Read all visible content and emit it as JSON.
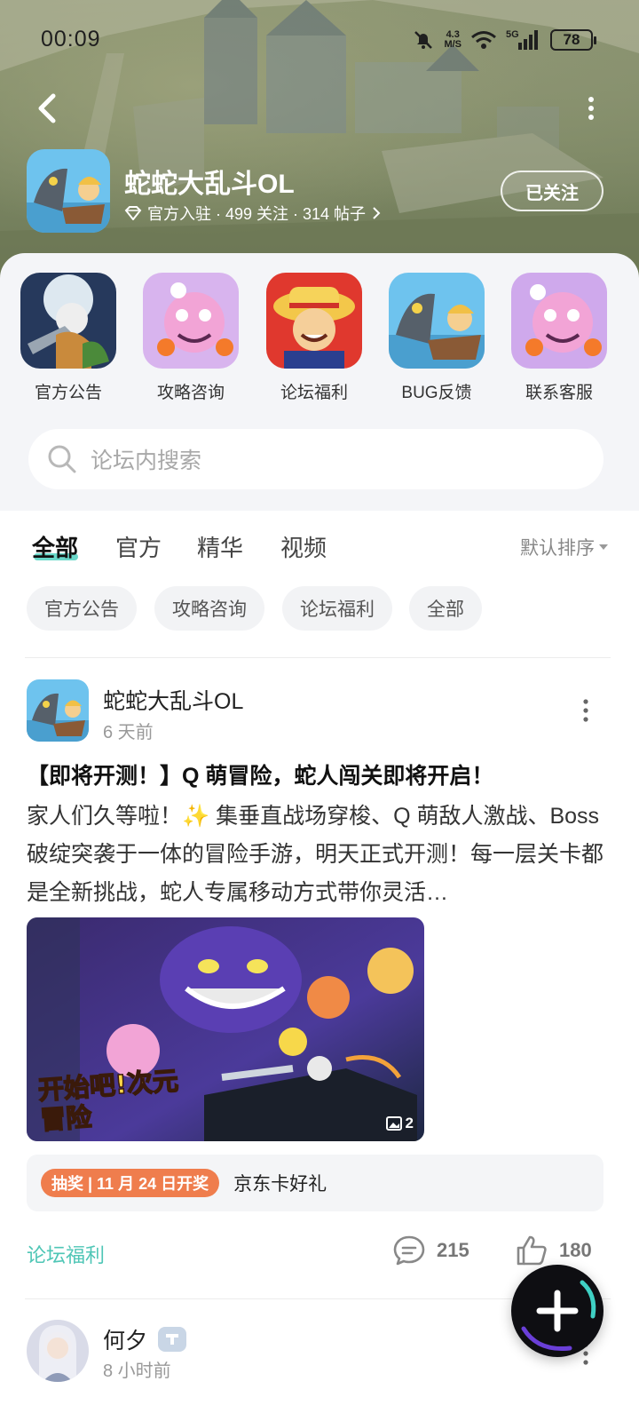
{
  "status": {
    "time": "00:09",
    "speed_value": "4.3",
    "speed_unit": "M/S",
    "network": "5G",
    "battery": "78"
  },
  "header": {
    "title": "蛇蛇大乱斗OL",
    "meta": "官方入驻 · 499 关注 · 314 帖子",
    "follow_label": "已关注"
  },
  "shortcuts": [
    {
      "label": "官方公告"
    },
    {
      "label": "攻略咨询"
    },
    {
      "label": "论坛福利"
    },
    {
      "label": "BUG反馈"
    },
    {
      "label": "联系客服"
    }
  ],
  "search": {
    "placeholder": "论坛内搜索"
  },
  "tabs": [
    {
      "label": "全部"
    },
    {
      "label": "官方"
    },
    {
      "label": "精华"
    },
    {
      "label": "视频"
    }
  ],
  "sort_label": "默认排序",
  "chips": [
    {
      "label": "官方公告"
    },
    {
      "label": "攻略咨询"
    },
    {
      "label": "论坛福利"
    },
    {
      "label": "全部"
    }
  ],
  "post": {
    "author": "蛇蛇大乱斗OL",
    "time": "6 天前",
    "title": "【即将开测！】Q 萌冒险，蛇人闯关即将开启！",
    "body": "家人们久等啦！✨ 集垂直战场穿梭、Q 萌敌人激战、Boss 破绽突袭于一体的冒险手游，明天正式开测！每一层关卡都是全新挑战，蛇人专属移动方式带你灵活…",
    "image_text": "开始吧!次元冒险",
    "image_count": "2",
    "lottery_badge": "抽奖 | 11 月 24 日开奖",
    "lottery_text": "京东卡好礼",
    "tag": "论坛福利",
    "comments": "215",
    "likes": "180"
  },
  "next_post": {
    "author": "何夕",
    "time": "8 小时前"
  },
  "colors": {
    "accent": "#4fd0c0",
    "lottery": "#ef7d4d",
    "fab": "#0e0e12"
  }
}
